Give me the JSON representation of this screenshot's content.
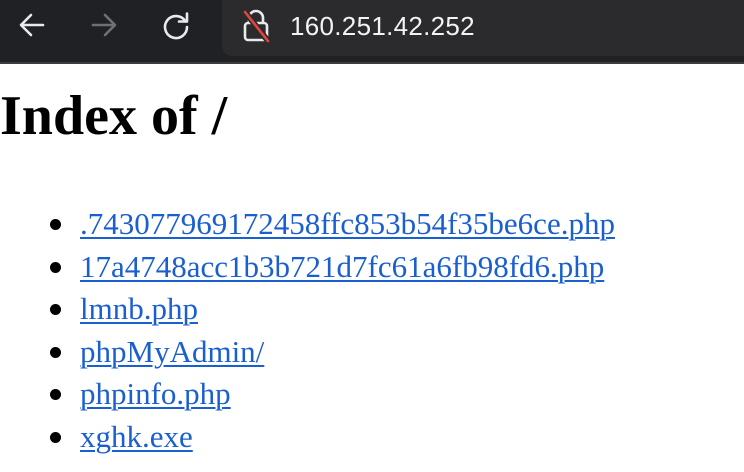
{
  "browser": {
    "url": "160.251.42.252",
    "connection_icon": "not-secure-lock-icon",
    "nav_icons": [
      "back-arrow-icon",
      "forward-arrow-icon",
      "reload-icon"
    ]
  },
  "page": {
    "heading": "Index of /",
    "entries": [
      {
        "name": ".743077969172458ffc853b54f35be6ce.php"
      },
      {
        "name": "17a4748acc1b3b721d7fc61a6fb98fd6.php"
      },
      {
        "name": "lmnb.php"
      },
      {
        "name": "phpMyAdmin/"
      },
      {
        "name": "phpinfo.php"
      },
      {
        "name": "xghk.exe"
      }
    ]
  },
  "colors": {
    "toolbar_bg": "#202124",
    "address_bg": "#2b2b2e",
    "link": "#1a5fd0",
    "insecure_slash": "#e0463c"
  }
}
